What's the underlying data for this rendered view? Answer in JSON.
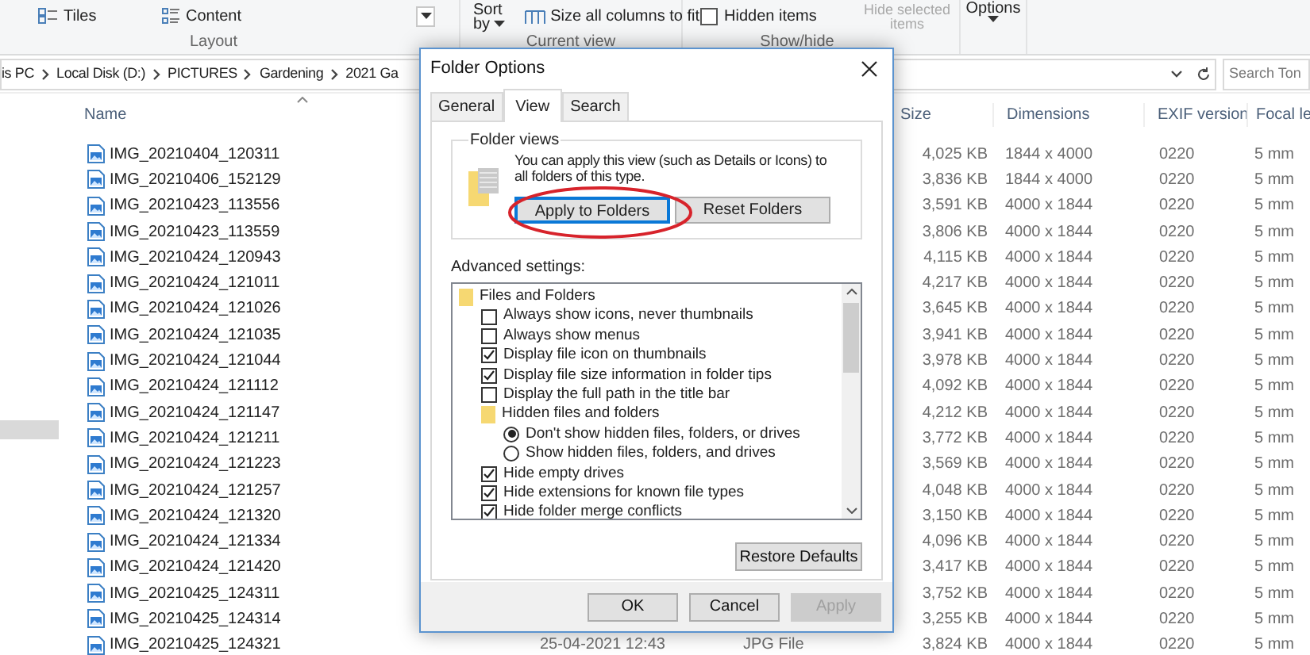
{
  "ribbon": {
    "tiles": "Tiles",
    "content": "Content",
    "sort": "Sort",
    "sort_by": "by",
    "size_columns": "Size all columns to fit",
    "hidden_items": {
      "label": "Hidden items",
      "checked": false
    },
    "hide_selected": [
      "Hide selected",
      "items"
    ],
    "options": "Options",
    "groups": [
      "Layout",
      "Current view",
      "Show/hide"
    ]
  },
  "address": {
    "crumbs": [
      "is PC",
      "Local Disk (D:)",
      "PICTURES",
      "Gardening",
      "2021 Ga"
    ],
    "search_placeholder": "Search Ton"
  },
  "columns": {
    "name": "Name",
    "size": "Size",
    "dimensions": "Dimensions",
    "exif": "EXIF version",
    "focal": "Focal le"
  },
  "rows": [
    {
      "name": "IMG_20210404_120311",
      "size": "4,025 KB",
      "dimensions": "1844 x 4000",
      "exif": "0220",
      "focal": "5 mm"
    },
    {
      "name": "IMG_20210406_152129",
      "size": "3,836 KB",
      "dimensions": "1844 x 4000",
      "exif": "0220",
      "focal": "5 mm"
    },
    {
      "name": "IMG_20210423_113556",
      "size": "3,591 KB",
      "dimensions": "4000 x 1844",
      "exif": "0220",
      "focal": "5 mm"
    },
    {
      "name": "IMG_20210423_113559",
      "size": "3,806 KB",
      "dimensions": "4000 x 1844",
      "exif": "0220",
      "focal": "5 mm"
    },
    {
      "name": "IMG_20210424_120943",
      "size": "4,115 KB",
      "dimensions": "4000 x 1844",
      "exif": "0220",
      "focal": "5 mm"
    },
    {
      "name": "IMG_20210424_121011",
      "size": "4,217 KB",
      "dimensions": "4000 x 1844",
      "exif": "0220",
      "focal": "5 mm"
    },
    {
      "name": "IMG_20210424_121026",
      "size": "3,645 KB",
      "dimensions": "4000 x 1844",
      "exif": "0220",
      "focal": "5 mm"
    },
    {
      "name": "IMG_20210424_121035",
      "size": "3,941 KB",
      "dimensions": "4000 x 1844",
      "exif": "0220",
      "focal": "5 mm"
    },
    {
      "name": "IMG_20210424_121044",
      "size": "3,978 KB",
      "dimensions": "4000 x 1844",
      "exif": "0220",
      "focal": "5 mm"
    },
    {
      "name": "IMG_20210424_121112",
      "size": "4,092 KB",
      "dimensions": "4000 x 1844",
      "exif": "0220",
      "focal": "5 mm"
    },
    {
      "name": "IMG_20210424_121147",
      "size": "4,212 KB",
      "dimensions": "4000 x 1844",
      "exif": "0220",
      "focal": "5 mm"
    },
    {
      "name": "IMG_20210424_121211",
      "size": "3,772 KB",
      "dimensions": "4000 x 1844",
      "exif": "0220",
      "focal": "5 mm"
    },
    {
      "name": "IMG_20210424_121223",
      "size": "3,569 KB",
      "dimensions": "4000 x 1844",
      "exif": "0220",
      "focal": "5 mm"
    },
    {
      "name": "IMG_20210424_121257",
      "size": "4,048 KB",
      "dimensions": "4000 x 1844",
      "exif": "0220",
      "focal": "5 mm"
    },
    {
      "name": "IMG_20210424_121320",
      "size": "3,150 KB",
      "dimensions": "4000 x 1844",
      "exif": "0220",
      "focal": "5 mm"
    },
    {
      "name": "IMG_20210424_121334",
      "size": "4,096 KB",
      "dimensions": "4000 x 1844",
      "exif": "0220",
      "focal": "5 mm"
    },
    {
      "name": "IMG_20210424_121420",
      "size": "3,417 KB",
      "dimensions": "4000 x 1844",
      "exif": "0220",
      "focal": "5 mm"
    },
    {
      "name": "IMG_20210425_124311",
      "size": "3,752 KB",
      "dimensions": "4000 x 1844",
      "exif": "0220",
      "focal": "5 mm"
    },
    {
      "name": "IMG_20210425_124314",
      "size": "3,255 KB",
      "dimensions": "4000 x 1844",
      "exif": "0220",
      "focal": "5 mm"
    },
    {
      "name": "IMG_20210425_124321",
      "date": "25-04-2021 12:43",
      "type": "JPG File",
      "size": "3,824 KB",
      "dimensions": "4000 x 1844",
      "exif": "0220",
      "focal": "5 mm"
    }
  ],
  "dialog": {
    "title": "Folder Options",
    "tabs": [
      {
        "label": "General",
        "selected": false
      },
      {
        "label": "View",
        "selected": true
      },
      {
        "label": "Search",
        "selected": false
      }
    ],
    "folder_views": {
      "legend": "Folder views",
      "text": "You can apply this view (such as Details or Icons) to all folders of this type.",
      "buttons": [
        {
          "label": "Apply to Folders",
          "focused": true
        },
        {
          "label": "Reset Folders",
          "focused": false
        }
      ]
    },
    "advanced_label": "Advanced settings:",
    "items": [
      {
        "kind": "folder",
        "label": "Files and Folders",
        "children": [
          {
            "kind": "checkbox",
            "label": "Always show icons, never thumbnails",
            "checked": false
          },
          {
            "kind": "checkbox",
            "label": "Always show menus",
            "checked": false
          },
          {
            "kind": "checkbox",
            "label": "Display file icon on thumbnails",
            "checked": true
          },
          {
            "kind": "checkbox",
            "label": "Display file size information in folder tips",
            "checked": true
          },
          {
            "kind": "checkbox",
            "label": "Display the full path in the title bar",
            "checked": false
          },
          {
            "kind": "folder",
            "label": "Hidden files and folders",
            "children": [
              {
                "kind": "radio",
                "label": "Don't show hidden files, folders, or drives",
                "selected": true
              },
              {
                "kind": "radio",
                "label": "Show hidden files, folders, and drives",
                "selected": false
              }
            ]
          },
          {
            "kind": "checkbox",
            "label": "Hide empty drives",
            "checked": true
          },
          {
            "kind": "checkbox",
            "label": "Hide extensions for known file types",
            "checked": true
          },
          {
            "kind": "checkbox",
            "label": "Hide folder merge conflicts",
            "checked": true
          }
        ]
      }
    ],
    "restore": "Restore Defaults",
    "footer": [
      {
        "label": "OK",
        "disabled": false
      },
      {
        "label": "Cancel",
        "disabled": false
      },
      {
        "label": "Apply",
        "disabled": true
      }
    ]
  }
}
